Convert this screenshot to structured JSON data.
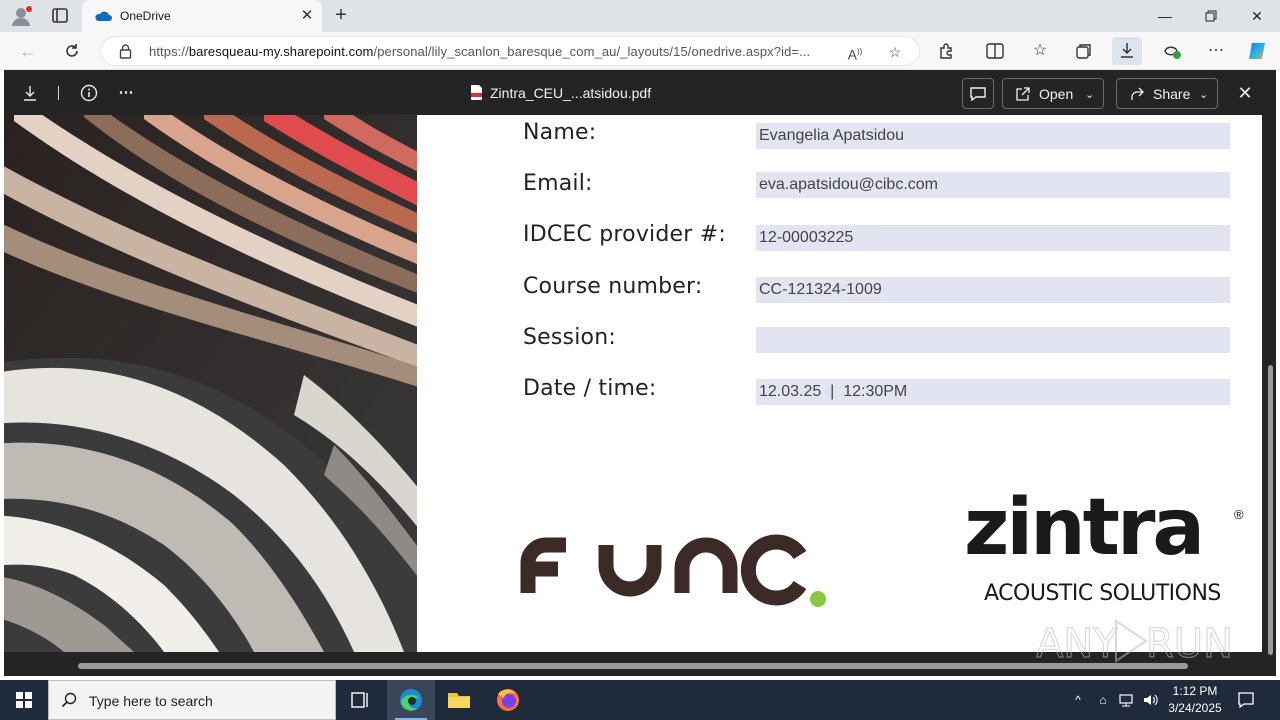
{
  "browser": {
    "tab_title": "OneDrive",
    "url_prefix": "https://",
    "url_host": "baresqueau-my.sharepoint.com",
    "url_path": "/personal/lily_scanlon_baresque_com_au/_layouts/15/onedrive.aspx?id=..."
  },
  "viewer": {
    "file_name": "Zintra_CEU_...atsidou.pdf",
    "open_label": "Open",
    "share_label": "Share"
  },
  "form": {
    "rows": [
      {
        "label": "Name:",
        "value": "Evangelia Apatsidou"
      },
      {
        "label": "Email:",
        "value": "eva.apatsidou@cibc.com"
      },
      {
        "label": "IDCEC provider #:",
        "value": "12-00003225"
      },
      {
        "label": "Course number:",
        "value": "CC-121324-1009"
      },
      {
        "label": "Session:",
        "value": ""
      },
      {
        "label": "Date / time:",
        "value": "12.03.25  |  12:30PM"
      }
    ]
  },
  "logos": {
    "func": "FUNC",
    "zintra": "zintra",
    "zintra_reg": "®",
    "zintra_tagline": "ACOUSTIC SOLUTIONS"
  },
  "watermark": "ANY RUN",
  "taskbar": {
    "search_placeholder": "Type here to search",
    "time": "1:12 PM",
    "date": "3/24/2025"
  },
  "colors": {
    "func_brown": "#3c2a26",
    "func_dot": "#8cc63f",
    "field_bg": "#e2e4f2",
    "viewer_bg": "#242424"
  }
}
